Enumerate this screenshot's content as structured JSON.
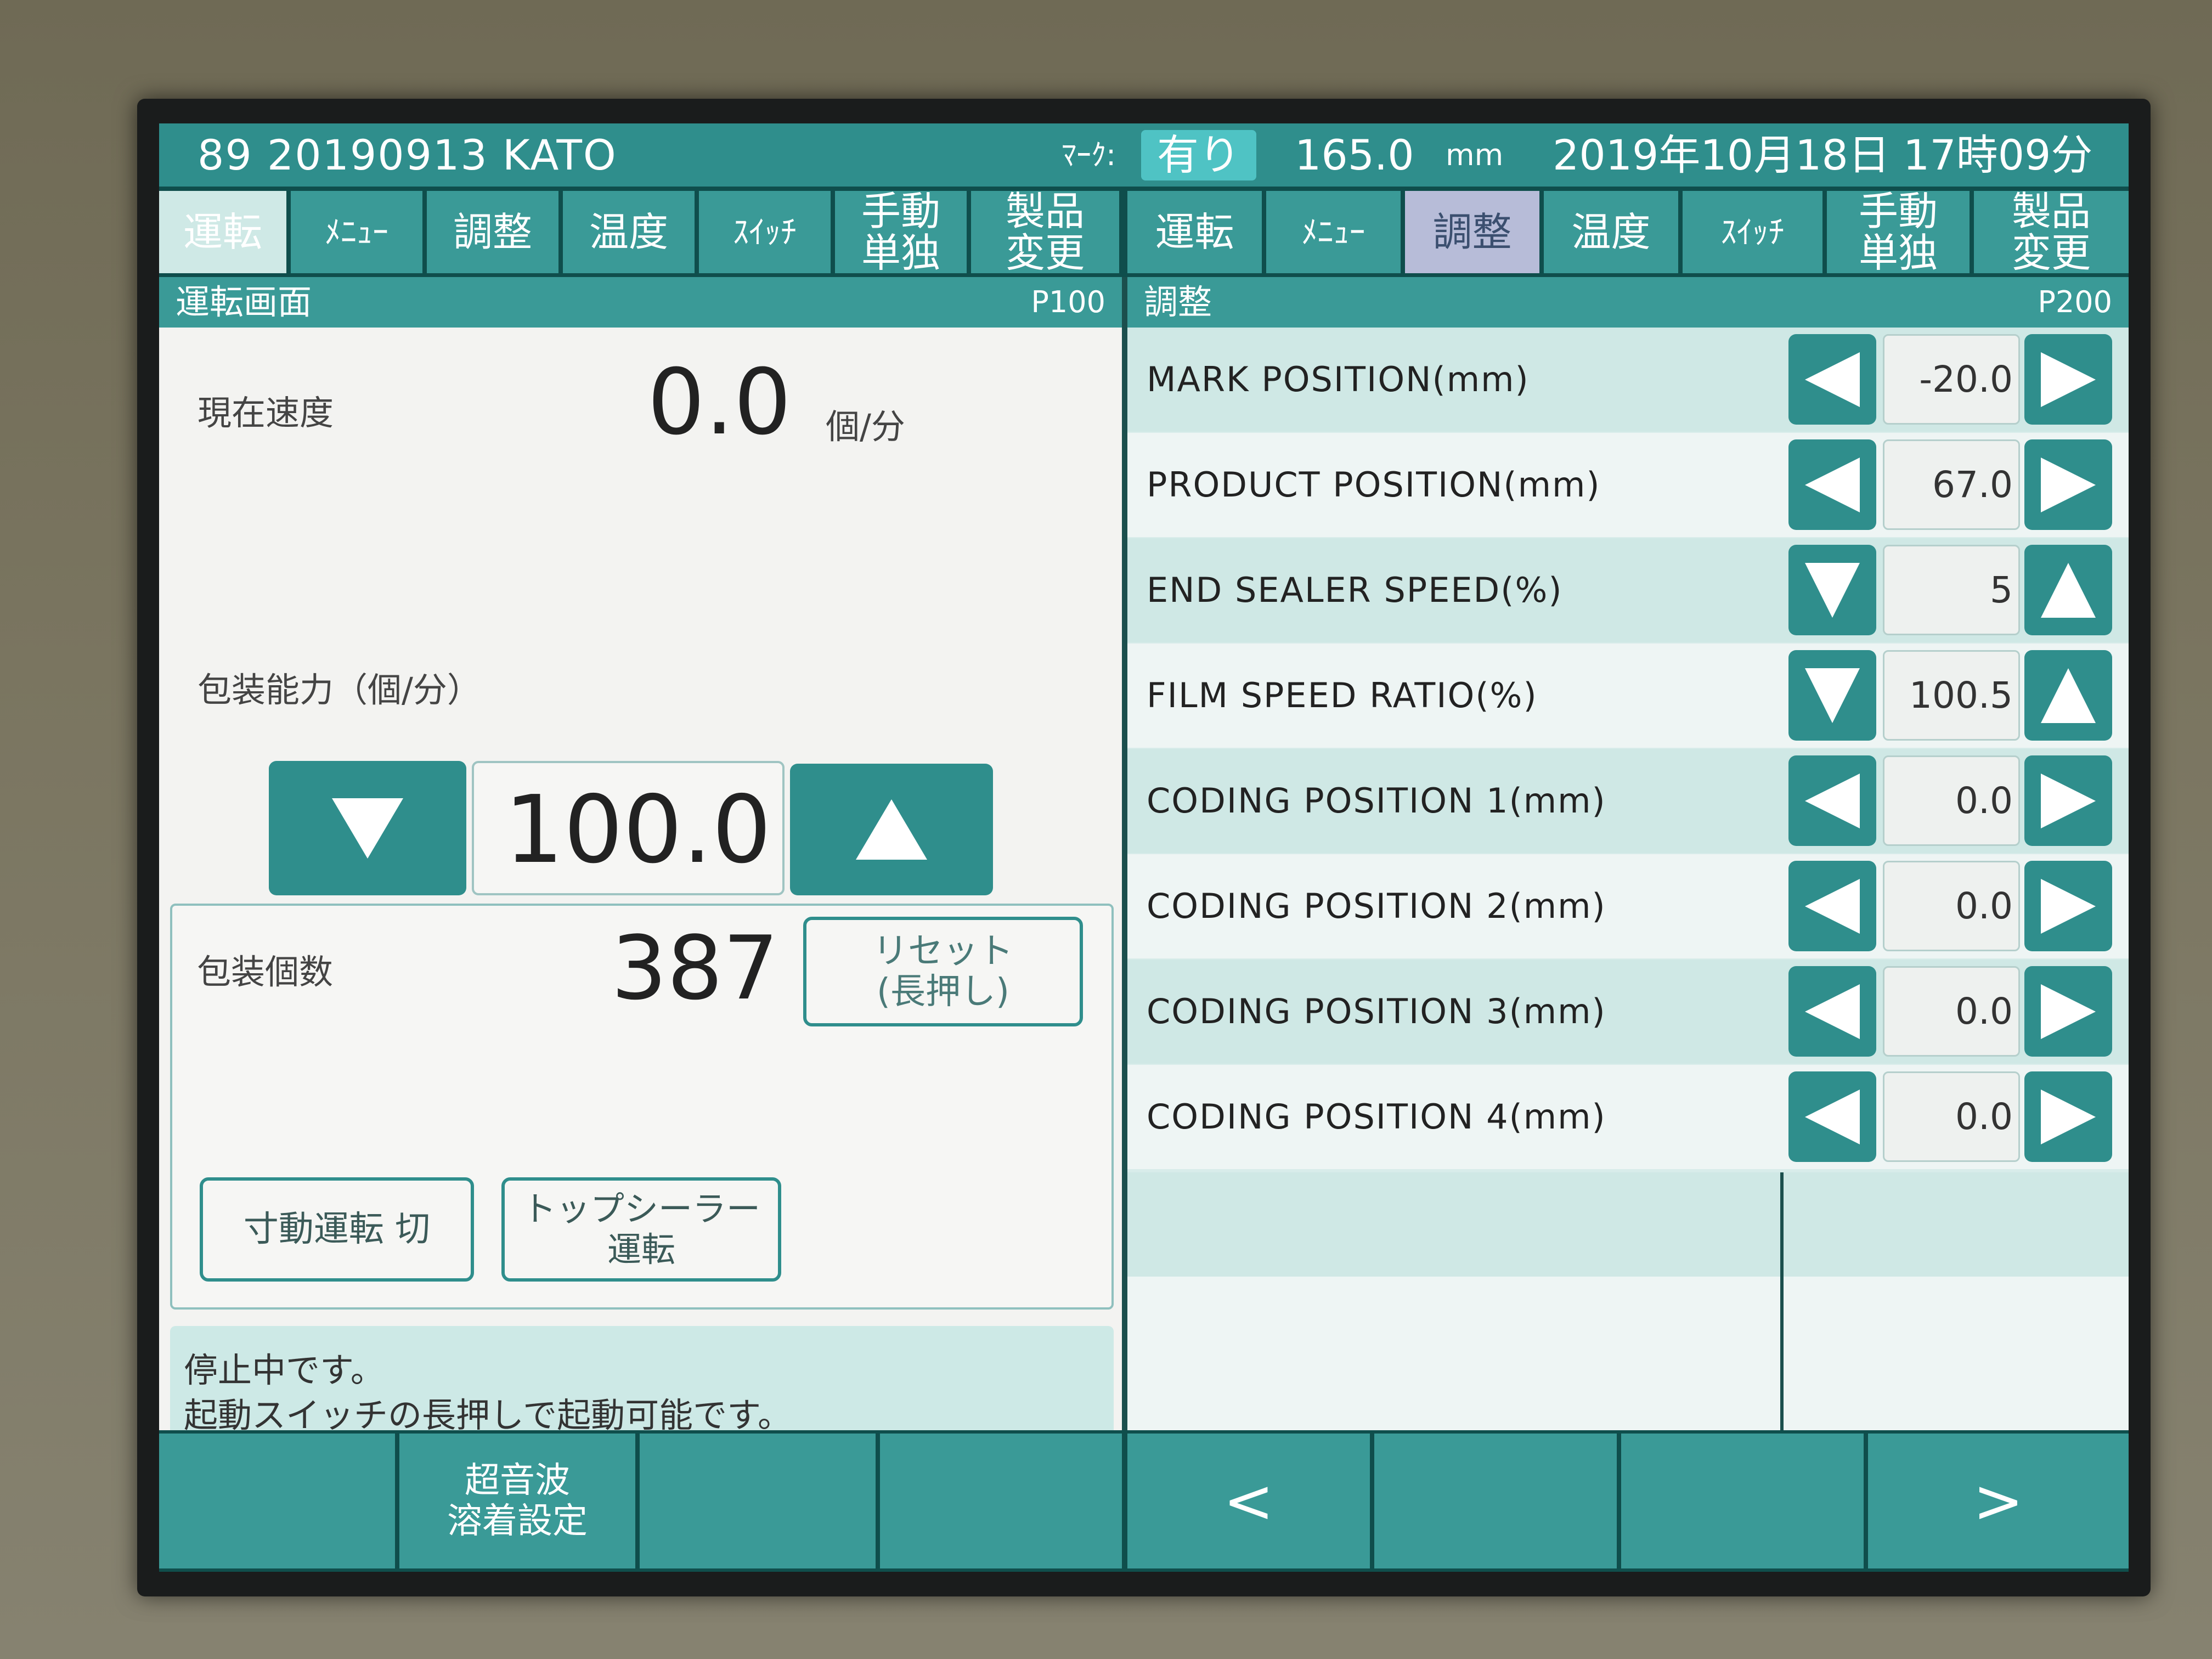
{
  "status_bar": {
    "line_id": "89  20190913 KATO",
    "mark_label": "ﾏｰｸ:",
    "mark_value": "有り",
    "length_value": "165.0",
    "length_unit": "mm",
    "datetime": "2019年10月18日 17時09分"
  },
  "tabs": [
    {
      "label": "運転",
      "active": false
    },
    {
      "label": "ﾒﾆｭｰ",
      "active": false
    },
    {
      "label": "調整",
      "active": false
    },
    {
      "label": "温度",
      "active": false
    },
    {
      "label": "ｽｲｯﾁ",
      "active": false
    },
    {
      "label": "手動\n単独",
      "active": false
    },
    {
      "label": "製品\n変更",
      "active": false
    },
    {
      "label": "運転",
      "active": false
    },
    {
      "label": "ﾒﾆｭｰ",
      "active": false
    },
    {
      "label": "調整",
      "active": true
    },
    {
      "label": "温度",
      "active": false
    },
    {
      "label": "ｽｲｯﾁ",
      "active": false
    },
    {
      "label": "手動\n単独",
      "active": false
    },
    {
      "label": "製品\n変更",
      "active": false
    }
  ],
  "left_panel": {
    "title": "運転画面",
    "code": "P100",
    "speed_label": "現在速度",
    "speed_value": "0.0",
    "speed_unit": "個/分",
    "capacity_label": "包装能力（個/分）",
    "capacity_value": "100.0",
    "count_label": "包装個数",
    "count_value": "387",
    "reset_button": "リセット\n(長押し)",
    "inching_button": "寸動運転 切",
    "top_sealer_button": "トップシーラー\n運転",
    "message": "停止中です。\n起動スイッチの長押しで起動可能です。"
  },
  "right_panel": {
    "title": "調整",
    "code": "P200",
    "params": [
      {
        "label": "MARK POSITION(mm)",
        "value": "-20.0",
        "buttons": "left-right"
      },
      {
        "label": "PRODUCT POSITION(mm)",
        "value": "67.0",
        "buttons": "left-right"
      },
      {
        "label": "END SEALER SPEED(%)",
        "value": "5",
        "buttons": "down-up"
      },
      {
        "label": "FILM SPEED RATIO(%)",
        "value": "100.5",
        "buttons": "down-up"
      },
      {
        "label": "CODING POSITION 1(mm)",
        "value": "0.0",
        "buttons": "left-right"
      },
      {
        "label": "CODING POSITION 2(mm)",
        "value": "0.0",
        "buttons": "left-right"
      },
      {
        "label": "CODING POSITION 3(mm)",
        "value": "0.0",
        "buttons": "left-right"
      },
      {
        "label": "CODING POSITION 4(mm)",
        "value": "0.0",
        "buttons": "left-right"
      }
    ]
  },
  "bottom_bar": {
    "left_buttons": [
      "",
      "超音波\n溶着設定",
      "",
      ""
    ],
    "right_buttons": [
      "<",
      "",
      "",
      ">"
    ]
  },
  "colors": {
    "teal": "#2f8e8c",
    "teal_dark": "#0f4e4c",
    "active_tab": "#b7bcd8",
    "mark_badge": "#4fc3c4"
  }
}
